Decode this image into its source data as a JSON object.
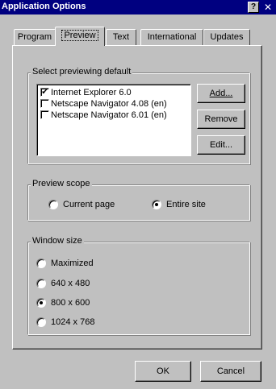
{
  "window": {
    "title": "Application Options",
    "help_glyph": "?",
    "close_glyph": "✕"
  },
  "tabs": [
    {
      "label": "Program",
      "active": false
    },
    {
      "label": "Preview",
      "active": true
    },
    {
      "label": "Text",
      "active": false
    },
    {
      "label": "International",
      "active": false
    },
    {
      "label": "Updates",
      "active": false
    }
  ],
  "preview_default": {
    "legend": "Select previewing default",
    "browsers": [
      {
        "label": "Internet Explorer 6.0",
        "checked": true
      },
      {
        "label": "Netscape Navigator 4.08 (en)",
        "checked": false
      },
      {
        "label": "Netscape Navigator 6.01 (en)",
        "checked": false
      }
    ],
    "add_label": "Add...",
    "remove_label": "Remove",
    "edit_label": "Edit..."
  },
  "preview_scope": {
    "legend": "Preview scope",
    "current_page_label": "Current page",
    "entire_site_label": "Entire site",
    "selected": "Entire site"
  },
  "window_size": {
    "legend": "Window size",
    "options": [
      {
        "label": "Maximized",
        "selected": false
      },
      {
        "label": "640 x 480",
        "selected": false
      },
      {
        "label": "800 x 600",
        "selected": true
      },
      {
        "label": "1024 x 768",
        "selected": false
      }
    ]
  },
  "footer": {
    "ok_label": "OK",
    "cancel_label": "Cancel"
  }
}
